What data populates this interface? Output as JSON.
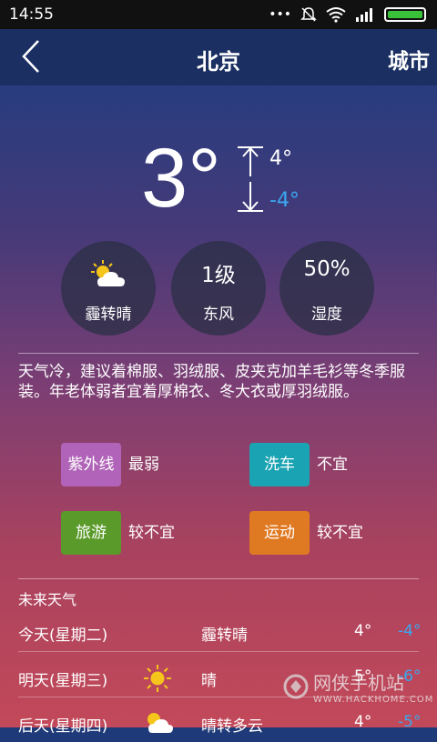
{
  "status": {
    "time": "14:55"
  },
  "header": {
    "title": "北京",
    "city_button": "城市"
  },
  "current": {
    "temp": "3°",
    "high": "4°",
    "low": "-4°",
    "condition": "霾转晴",
    "wind_level": "1级",
    "wind_dir": "东风",
    "humidity": "50%",
    "humidity_label": "湿度"
  },
  "advice": "天气冷，建议着棉服、羽绒服、皮夹克加羊毛衫等冬季服装。年老体弱者宜着厚棉衣、冬大衣或厚羽绒服。",
  "indices": [
    {
      "label": "紫外线",
      "value": "最弱",
      "color": "#b063b8"
    },
    {
      "label": "洗车",
      "value": "不宜",
      "color": "#1aa3b2"
    },
    {
      "label": "旅游",
      "value": "较不宜",
      "color": "#5a9a2a"
    },
    {
      "label": "运动",
      "value": "较不宜",
      "color": "#e07a22"
    }
  ],
  "forecast_title": "未来天气",
  "forecast": [
    {
      "day": "今天(星期二)",
      "icon": "none",
      "condition": "霾转晴",
      "high": "4°",
      "low": "-4°"
    },
    {
      "day": "明天(星期三)",
      "icon": "sun-icon",
      "condition": "晴",
      "high": "5°",
      "low": "-6°"
    },
    {
      "day": "后天(星期四)",
      "icon": "partly-cloudy-icon",
      "condition": "晴转多云",
      "high": "4°",
      "low": "-5°"
    }
  ],
  "watermark": {
    "brand": "网侠手机站",
    "url": "WWW.HACKHOME.COM"
  }
}
